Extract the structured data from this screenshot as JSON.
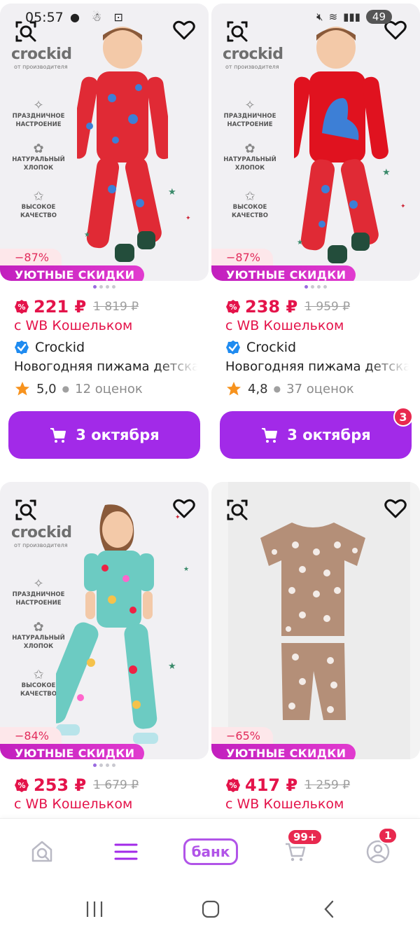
{
  "status_bar": {
    "time": "05:57",
    "battery": "49"
  },
  "products": [
    {
      "brand_logo": "crockid",
      "brand_logo_sub": "от производителя",
      "features": [
        "ПРАЗДНИЧНОЕ НАСТРОЕНИЕ",
        "НАТУРАЛЬНЫЙ ХЛОПОК",
        "ВЫСОКОЕ КАЧЕСТВО"
      ],
      "discount": "−87%",
      "promo": "УЮТНЫЕ СКИДКИ",
      "price": "221 ₽",
      "old_price": "1 819 ₽",
      "wallet": "с WB Кошельком",
      "seller": "Crockid",
      "title": "Новогодняя пижама детская",
      "rating": "5,0",
      "reviews": "12 оценок",
      "cart_label": "3 октября",
      "cart_badge": ""
    },
    {
      "brand_logo": "crockid",
      "brand_logo_sub": "от производителя",
      "features": [
        "ПРАЗДНИЧНОЕ НАСТРОЕНИЕ",
        "НАТУРАЛЬНЫЙ ХЛОПОК",
        "ВЫСОКОЕ КАЧЕСТВО"
      ],
      "discount": "−87%",
      "promo": "УЮТНЫЕ СКИДКИ",
      "price": "238 ₽",
      "old_price": "1 959 ₽",
      "wallet": "с WB Кошельком",
      "seller": "Crockid",
      "title": "Новогодняя пижама детская",
      "rating": "4,8",
      "reviews": "37 оценок",
      "cart_label": "3 октября",
      "cart_badge": "3"
    },
    {
      "brand_logo": "crockid",
      "brand_logo_sub": "от производителя",
      "features": [
        "ПРАЗДНИЧНОЕ НАСТРОЕНИЕ",
        "НАТУРАЛЬНЫЙ ХЛОПОК",
        "ВЫСОКОЕ КАЧЕСТВО"
      ],
      "discount": "−84%",
      "promo": "УЮТНЫЕ СКИДКИ",
      "price": "253 ₽",
      "old_price": "1 679 ₽",
      "wallet": "с WB Кошельком"
    },
    {
      "discount": "−65%",
      "promo": "УЮТНЫЕ СКИДКИ",
      "price": "417 ₽",
      "old_price": "1 259 ₽",
      "wallet": "с WB Кошельком"
    }
  ],
  "bottom_nav": {
    "bank_label": "банк",
    "cart_badge": "99+",
    "profile_badge": "1"
  },
  "colors": {
    "accent": "#a22ae8",
    "price": "#e4134a",
    "promo": "#c21fbe"
  }
}
